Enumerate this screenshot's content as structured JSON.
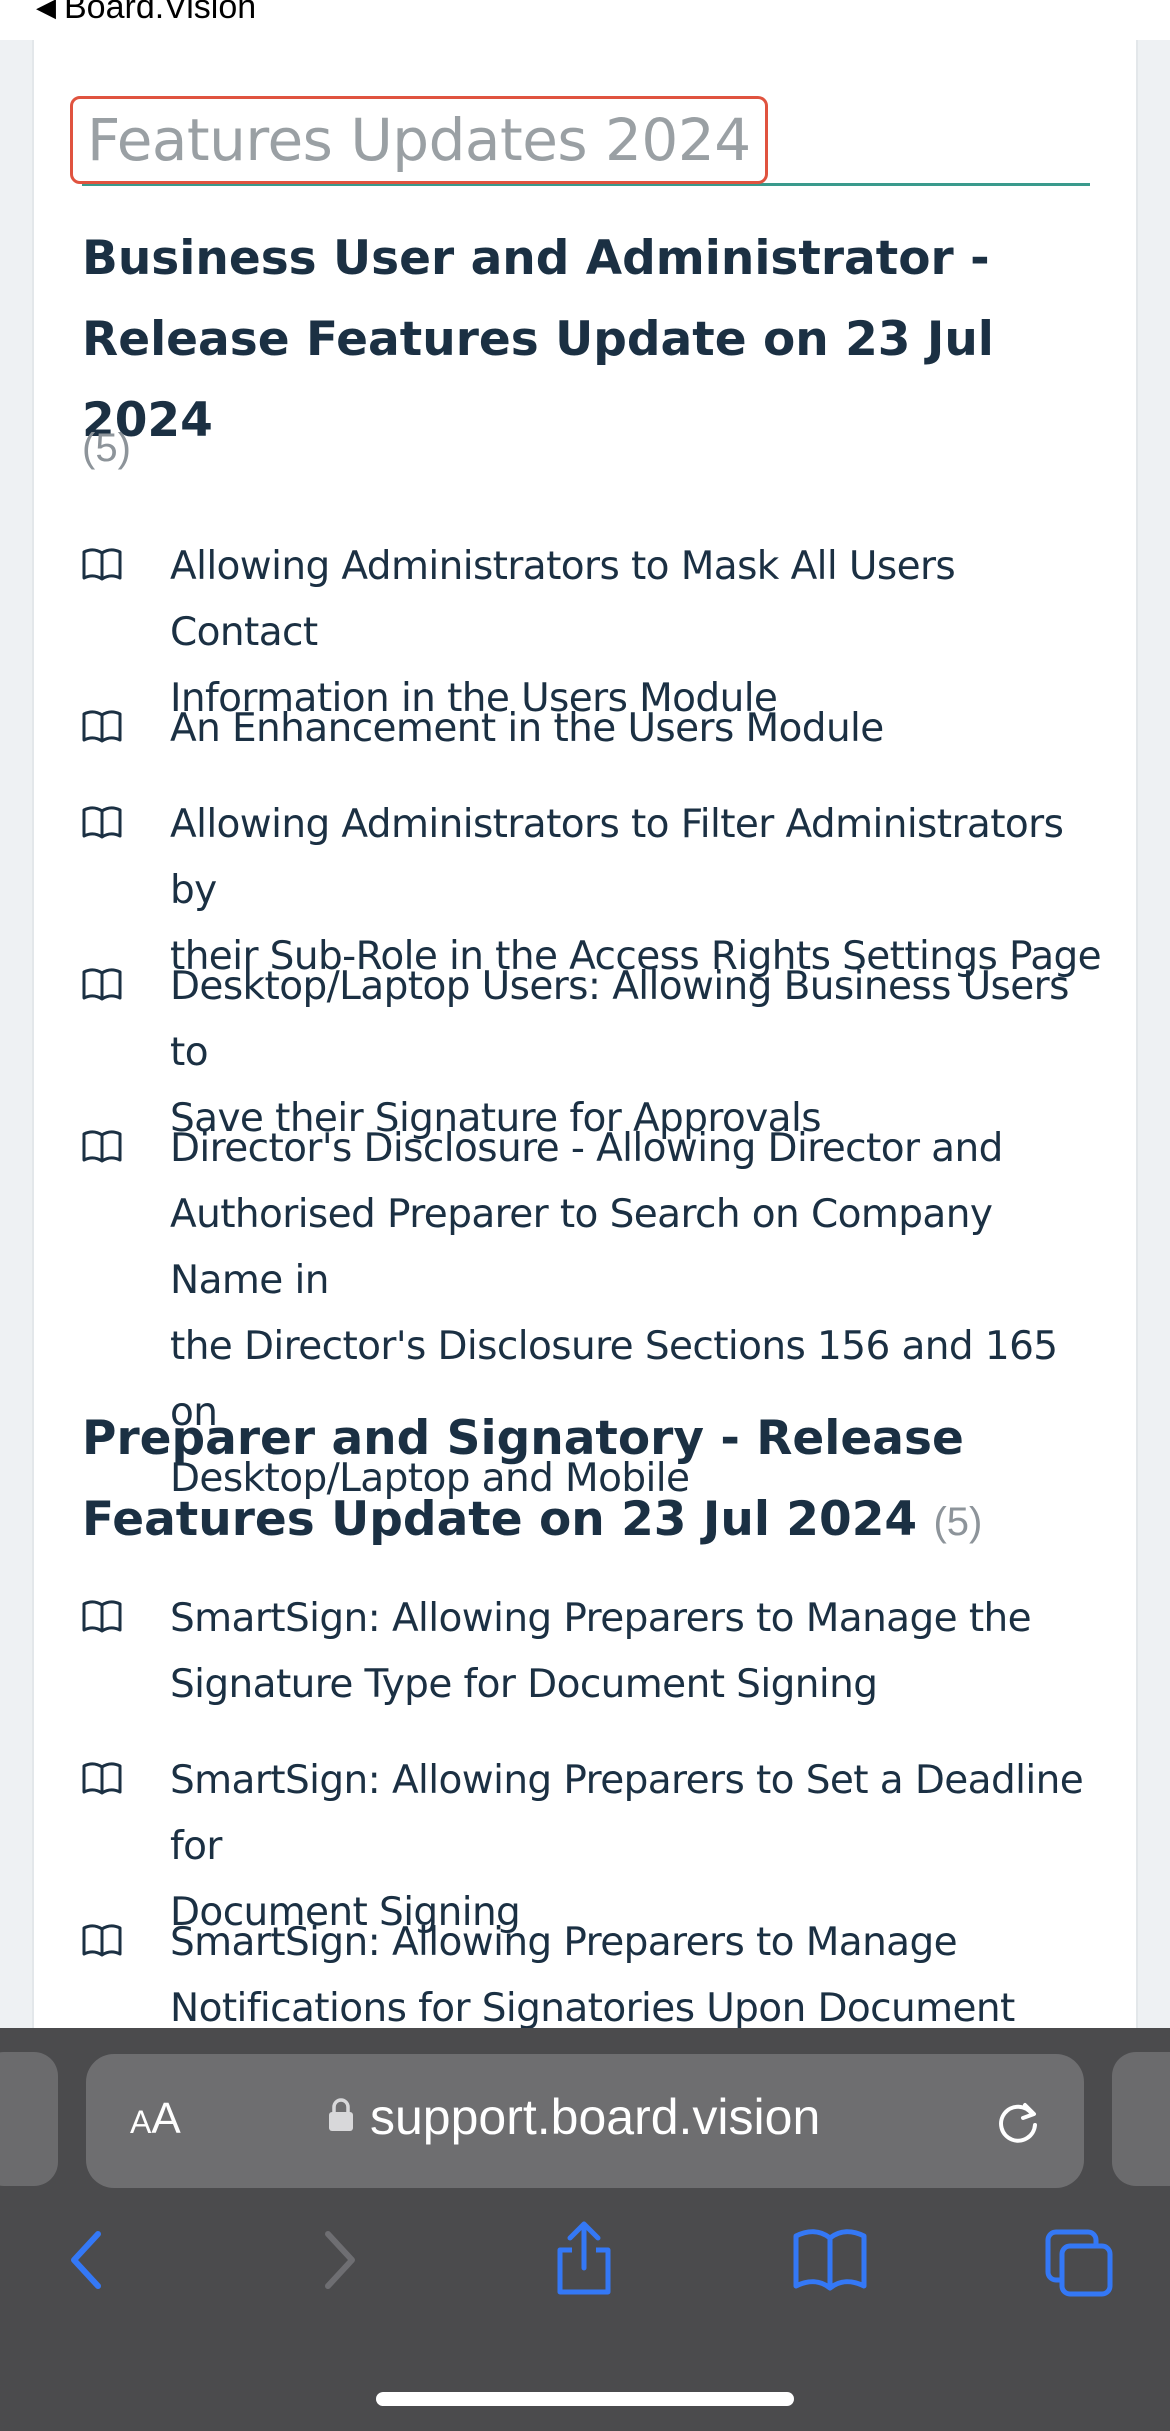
{
  "top": {
    "back_label": "Board.Vision"
  },
  "section": {
    "title": "Features Updates 2024"
  },
  "groups": [
    {
      "title_line1": "Business User and Administrator -",
      "title_line2": "Release Features Update on 23 Jul 2024",
      "count": "(5)",
      "articles": [
        {
          "line1": "Allowing Administrators to Mask All Users Contact",
          "line2": "Information in the Users Module"
        },
        {
          "line1": "An Enhancement in the Users Module"
        },
        {
          "line1": "Allowing Administrators to Filter Administrators by",
          "line2": "their Sub-Role in the Access Rights Settings Page"
        },
        {
          "line1": "Desktop/Laptop Users: Allowing Business Users to",
          "line2": "Save their Signature for Approvals"
        },
        {
          "line1": "Director's Disclosure - Allowing Director and",
          "line2": "Authorised Preparer to Search on Company Name in",
          "line3": "the Director's Disclosure Sections 156 and 165 on",
          "line4": "Desktop/Laptop and Mobile"
        }
      ]
    },
    {
      "title_line1": "Preparer and Signatory - Release",
      "title_line2": "Features Update on 23 Jul 2024",
      "count": "(5)",
      "articles": [
        {
          "line1": "SmartSign: Allowing Preparers to Manage the",
          "line2": "Signature Type for Document Signing"
        },
        {
          "line1": "SmartSign: Allowing Preparers to Set a Deadline for",
          "line2": "Document Signing"
        },
        {
          "line1": "SmartSign: Allowing Preparers to Manage",
          "line2": "Notifications for Signatories Upon Document"
        }
      ]
    }
  ],
  "browser": {
    "aa_small": "A",
    "aa_large": "A",
    "url": "support.board.vision",
    "icons": [
      "lock-icon",
      "reload-icon",
      "back-icon",
      "forward-icon",
      "share-icon",
      "bookmarks-icon",
      "tabs-icon"
    ],
    "accent_color": "#3478f6"
  }
}
